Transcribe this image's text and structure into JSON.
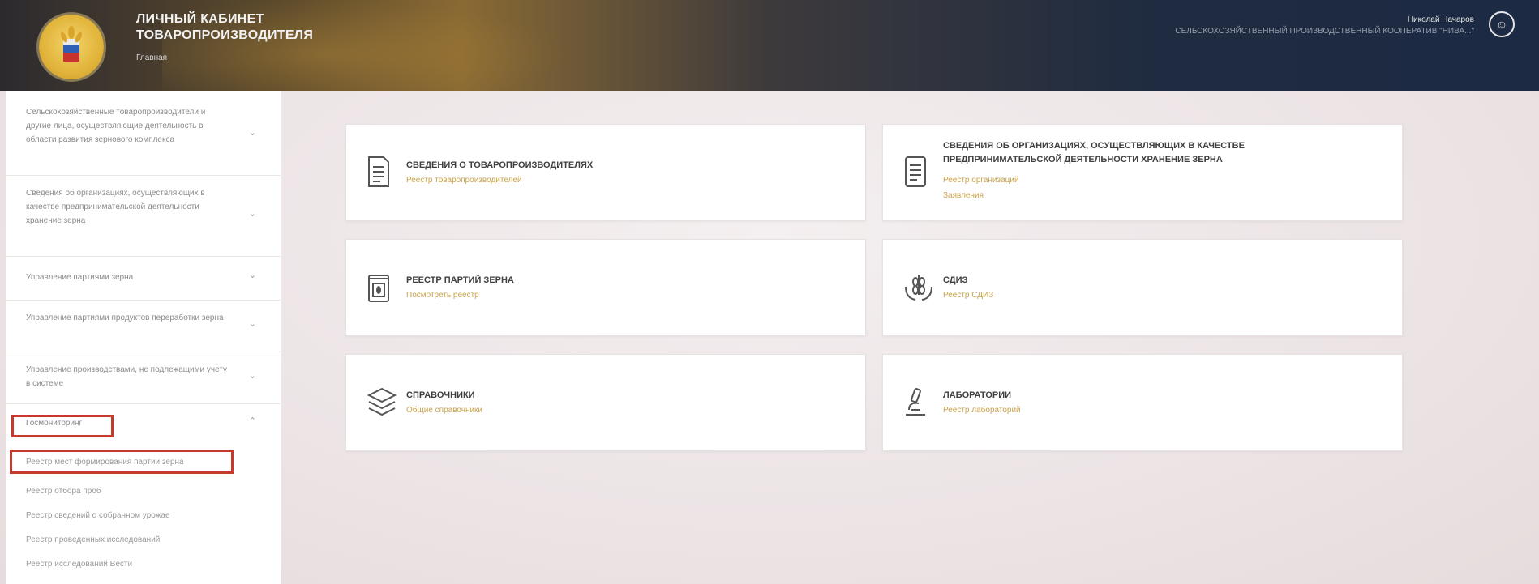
{
  "header": {
    "title_line1": "ЛИЧНЫЙ КАБИНЕТ",
    "title_line2": "ТОВАРОПРОИЗВОДИТЕЛЯ",
    "subtitle": "Главная",
    "user_name": "Николай Начаров",
    "organization": "СЕЛЬСКОХОЗЯЙСТВЕННЫЙ ПРОИЗВОДСТВЕННЫЙ КООПЕРАТИВ \"НИВА...\"",
    "user_icon": "user-circle-icon"
  },
  "sidebar": {
    "items": [
      {
        "label": "Сельскохозяйственные товаропроизводители и другие лица, осуществляющие деятельность в области развития зернового комплекса",
        "chevron": "chevron-down-icon"
      },
      {
        "label": "Сведения об организациях, осуществляющих в качестве предпринимательской деятельности хранение зерна",
        "chevron": "chevron-down-icon"
      },
      {
        "label": "Управление партиями зерна",
        "chevron": "chevron-down-icon"
      },
      {
        "label": "Управление партиями продуктов переработки зерна",
        "chevron": "chevron-down-icon"
      },
      {
        "label": "Управление производствами, не подлежащими учету в системе",
        "chevron": "chevron-down-icon"
      },
      {
        "label": "Госмониторинг",
        "chevron": "chevron-up-icon"
      }
    ],
    "sub_links": [
      "Реестр мест формирования партии зерна",
      "Реестр отбора проб",
      "Реестр сведений о собранном урожае",
      "Реестр проведенных исследований",
      "Реестр исследований Вести"
    ]
  },
  "cards": [
    {
      "title": "СВЕДЕНИЯ О ТОВАРОПРОИЗВОДИТЕЛЯХ",
      "links": [
        "Реестр товаропроизводителей"
      ],
      "icon": "document-icon"
    },
    {
      "title_line1": "СВЕДЕНИЯ ОБ ОРГАНИЗАЦИЯХ, ОСУЩЕСТВЛЯЮЩИХ В КАЧЕСТВЕ",
      "title_line2": "ПРЕДПРИНИМАТЕЛЬСКОЙ ДЕЯТЕЛЬНОСТИ ХРАНЕНИЕ ЗЕРНА",
      "links": [
        "Реестр организаций",
        "Заявления"
      ],
      "icon": "document-list-icon"
    },
    {
      "title": "РЕЕСТР ПАРТИЙ ЗЕРНА",
      "links": [
        "Посмотреть реестр"
      ],
      "icon": "grain-bag-icon"
    },
    {
      "title": "СДИЗ",
      "links": [
        "Реестр СДИЗ"
      ],
      "icon": "hands-grain-icon"
    },
    {
      "title": "СПРАВОЧНИКИ",
      "links": [
        "Общие справочники"
      ],
      "icon": "layers-icon"
    },
    {
      "title": "ЛАБОРАТОРИИ",
      "links": [
        "Реестр лабораторий"
      ],
      "icon": "microscope-icon"
    }
  ],
  "colors": {
    "accent_link": "#c9a24a",
    "highlight_box": "#c63a2b",
    "header_dark": "#1c2a44"
  }
}
